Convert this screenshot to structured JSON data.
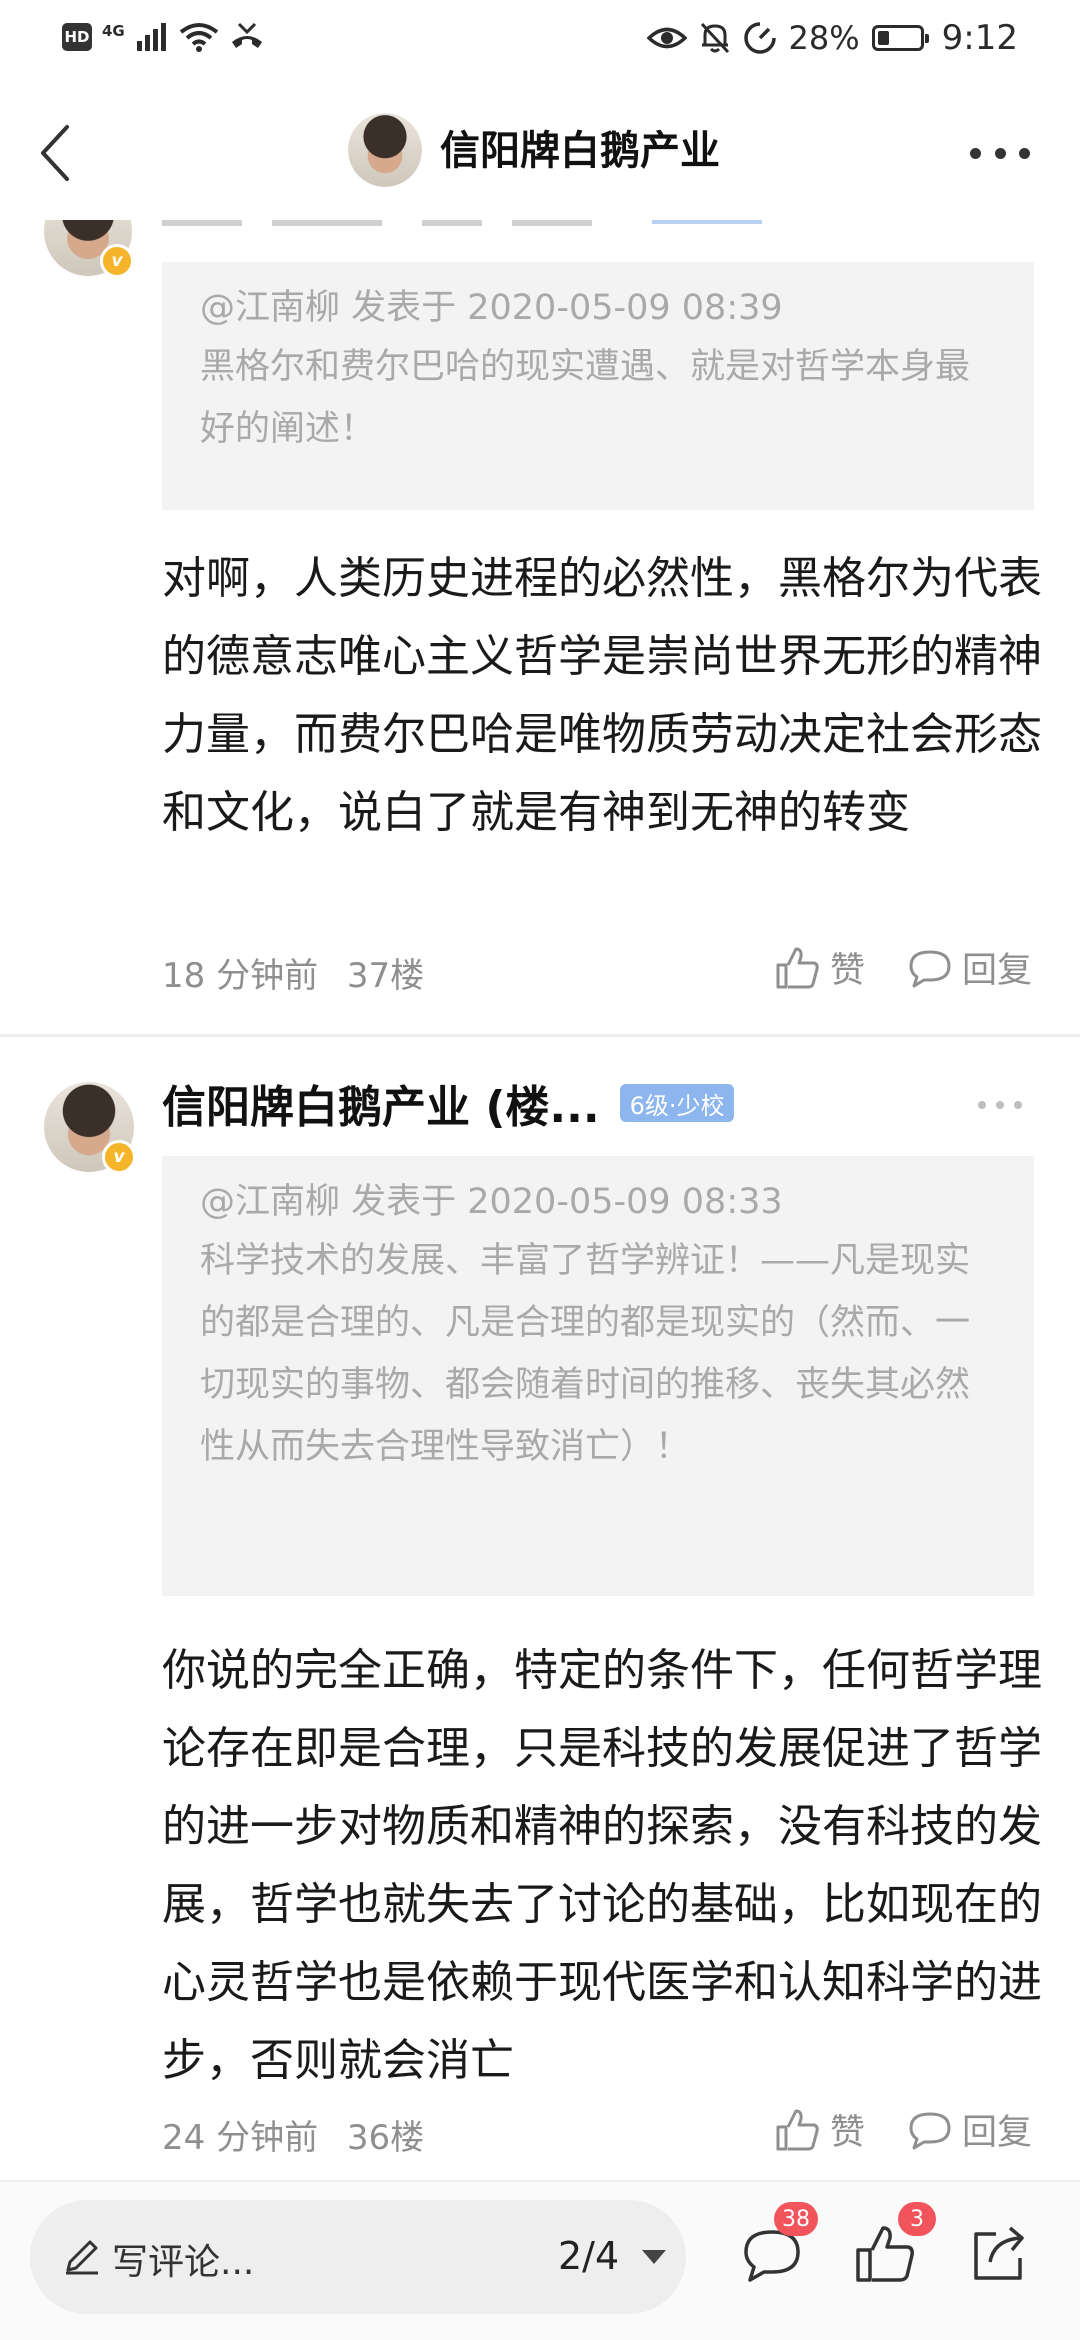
{
  "status_bar": {
    "hd": "HD",
    "network": "4G",
    "battery_percent": "28%",
    "battery_level": 0.28,
    "time": "9:12"
  },
  "header": {
    "title": "信阳牌白鹅产业",
    "back_icon": "chevron-left-icon",
    "more_icon": "more-horizontal-icon"
  },
  "comments": [
    {
      "quote": {
        "meta": "@江南柳 发表于 2020-05-09 08:39",
        "text": "黑格尔和费尔巴哈的现实遭遇、就是对哲学本身最好的阐述！"
      },
      "text": "对啊，人类历史进程的必然性，黑格尔为代表的德意志唯心主义哲学是崇尚世界无形的精神力量，而费尔巴哈是唯物质劳动决定社会形态和文化，说白了就是有神到无神的转变",
      "time": "18 分钟前",
      "floor": "37楼",
      "like_label": "赞",
      "reply_label": "回复"
    },
    {
      "author": "信阳牌白鹅产业 (楼...",
      "level": "6级·少校",
      "quote": {
        "meta": "@江南柳 发表于 2020-05-09 08:33",
        "text": "科学技术的发展、丰富了哲学辨证！——凡是现实的都是合理的、凡是合理的都是现实的（然而、一切现实的事物、都会随着时间的推移、丧失其必然性从而失去合理性导致消亡）！"
      },
      "text": "你说的完全正确，特定的条件下，任何哲学理论存在即是合理，只是科技的发展促进了哲学的进一步对物质和精神的探索，没有科技的发展，哲学也就失去了讨论的基础，比如现在的心灵哲学也是依赖于现代医学和认知科学的进步，否则就会消亡",
      "time": "24 分钟前",
      "floor": "36楼",
      "like_label": "赞",
      "reply_label": "回复"
    }
  ],
  "bottom_bar": {
    "compose_placeholder": "写评论...",
    "page": "2/4",
    "comments_count": "38",
    "likes_count": "3"
  },
  "colors": {
    "level_badge": "#8db5ee",
    "badge_red": "#f2545b",
    "verified": "#f5b52b"
  }
}
